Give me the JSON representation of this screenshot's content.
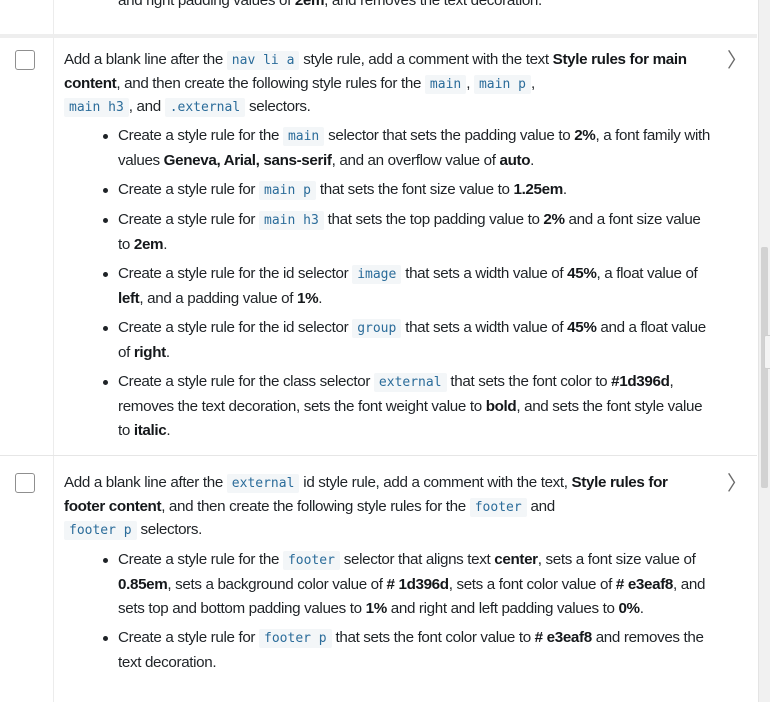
{
  "previous_fragment": {
    "parts": [
      "and right padding values of ",
      "2em",
      ", and removes the text decoration."
    ]
  },
  "tasks": [
    {
      "checked": false,
      "lead": {
        "t1": "Add a blank line after the ",
        "c1": "nav li a",
        "t2": " style rule, add a comment with the text ",
        "b1": "Style rules for main content",
        "t3": ", and then create the following style rules for the ",
        "c2": "main",
        "t4": ", ",
        "c3": "main p",
        "t5": ",",
        "c4": "main h3",
        "t6": ", and ",
        "c5": ".external",
        "t7": " selectors."
      },
      "bullets": [
        {
          "t1": "Create a style rule for the ",
          "c1": "main",
          "t2": " selector that sets the padding value to ",
          "b1": "2%",
          "t3": ", a font family with values ",
          "b2": "Geneva, Arial, sans-serif",
          "t4": ", and an overflow value of ",
          "b3": "auto",
          "t5": "."
        },
        {
          "t1": "Create a style rule for ",
          "c1": "main p",
          "t2": " that sets the font size value to ",
          "b1": "1.25em",
          "t3": "."
        },
        {
          "t1": "Create a style rule for ",
          "c1": "main h3",
          "t2": " that sets the top padding value to ",
          "b1": "2%",
          "t3": " and a font size value to ",
          "b2": "2em",
          "t4": "."
        },
        {
          "t1": "Create a style rule for the id selector ",
          "c1": "image",
          "t2": " that sets a width value of ",
          "b1": "45%",
          "t3": ", a float value of ",
          "b2": "left",
          "t4": ", and a padding value of ",
          "b3": "1%",
          "t5": "."
        },
        {
          "t1": "Create a style rule for the id selector ",
          "c1": "group",
          "t2": " that sets a width value of ",
          "b1": "45%",
          "t3": " and a float value of ",
          "b2": "right",
          "t4": "."
        },
        {
          "t1": "Create a style rule for the class selector ",
          "c1": "external",
          "t2": " that sets the font color to ",
          "b1": "#1d396d",
          "t3": ", removes the text decoration, sets the font weight value to ",
          "b2": "bold",
          "t4": ", and sets the font style value to ",
          "b3": "italic",
          "t5": "."
        }
      ]
    },
    {
      "checked": false,
      "lead": {
        "t1": "Add a blank line after the ",
        "c1": "external",
        "t2": " id style rule, add a comment with the text, ",
        "b1": "Style rules for footer content",
        "t3": ", and then create the following style rules for the ",
        "c2": "footer",
        "t4": " and ",
        "c3": "footer p",
        "t5": " selectors."
      },
      "bullets": [
        {
          "t1": "Create a style rule for the ",
          "c1": "footer",
          "t2": " selector that aligns text ",
          "b1": "center",
          "t3": ", sets a font size value of ",
          "b2": "0.85em",
          "t4": ", sets a background color value of ",
          "b3": "# 1d396d",
          "t5": ", sets a font color value of ",
          "b4": "# e3eaf8",
          "t6": ", and sets top and bottom padding values to ",
          "b5": "1%",
          "t7": " and right and left padding values to ",
          "b6": "0%",
          "t8": "."
        },
        {
          "t1": "Create a style rule for ",
          "c1": "footer p",
          "t2": " that sets the font color value to ",
          "b1": "# e3eaf8",
          "t3": " and removes the text decoration."
        }
      ]
    }
  ],
  "colors": {
    "code_text": "#2b6c9a",
    "code_background": "#f3f6f8",
    "divider": "#e6e6e6"
  }
}
